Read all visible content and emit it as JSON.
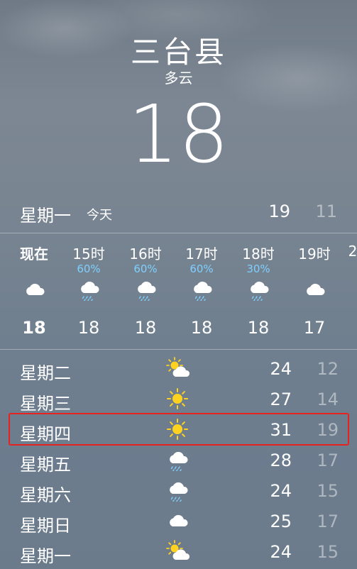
{
  "location": {
    "city": "三台县",
    "condition": "多云",
    "current_temp": "18"
  },
  "today": {
    "day": "星期一",
    "tag": "今天",
    "high": "19",
    "low": "11"
  },
  "hourly": [
    {
      "time": "现在",
      "precip": "",
      "icon": "cloud-icon",
      "temp": "18"
    },
    {
      "time": "15时",
      "precip": "60%",
      "icon": "rain-cloud-icon",
      "temp": "18"
    },
    {
      "time": "16时",
      "precip": "60%",
      "icon": "rain-cloud-icon",
      "temp": "18"
    },
    {
      "time": "17时",
      "precip": "60%",
      "icon": "rain-cloud-icon",
      "temp": "18"
    },
    {
      "time": "18时",
      "precip": "30%",
      "icon": "rain-cloud-icon",
      "temp": "18"
    },
    {
      "time": "19时",
      "precip": "",
      "icon": "cloud-icon",
      "temp": "17"
    },
    {
      "time": "2",
      "precip": "",
      "icon": "",
      "temp": ""
    }
  ],
  "daily": [
    {
      "day": "星期二",
      "icon": "partly-sunny-icon",
      "high": "24",
      "low": "12"
    },
    {
      "day": "星期三",
      "icon": "sun-icon",
      "high": "27",
      "low": "14"
    },
    {
      "day": "星期四",
      "icon": "sun-icon",
      "high": "31",
      "low": "19"
    },
    {
      "day": "星期五",
      "icon": "rain-cloud-icon",
      "high": "28",
      "low": "17"
    },
    {
      "day": "星期六",
      "icon": "rain-cloud-icon",
      "high": "24",
      "low": "15"
    },
    {
      "day": "星期日",
      "icon": "cloud-icon",
      "high": "25",
      "low": "17"
    },
    {
      "day": "星期一",
      "icon": "partly-sunny-icon",
      "high": "24",
      "low": "15"
    }
  ],
  "colors": {
    "precip": "#7fd0ff",
    "sun": "#ffd21f",
    "highlight": "#e8221e"
  }
}
